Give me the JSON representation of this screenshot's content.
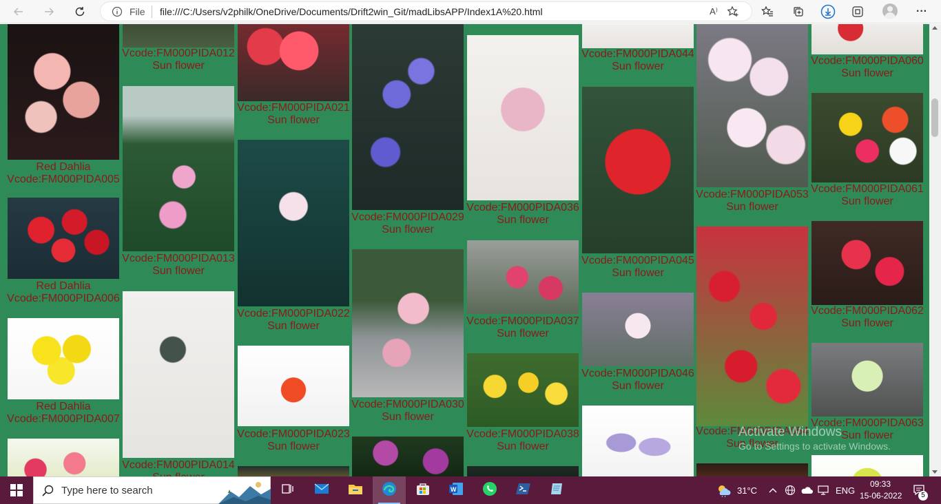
{
  "browser": {
    "back_icon": "arrow-left-icon",
    "forward_icon": "arrow-right-icon",
    "refresh_icon": "refresh-icon",
    "address_label": "File",
    "url": "file:///C:/Users/v2philk/OneDrive/Documents/Drift2win_Git/madLibsAPP/Index1A%20.html",
    "read_aloud_label": "A⁾",
    "more_label": "···"
  },
  "page": {
    "background": "#2e8b57",
    "caption_color": "#8b1a1a",
    "columns": [
      {
        "cards": [
          {
            "name": "Red Dahlia",
            "code": "Vcode:FM000PIDA005",
            "palette": "pinkrose"
          },
          {
            "name": "Red Dahlia",
            "code": "Vcode:FM000PIDA006",
            "palette": "redgerbera"
          },
          {
            "name": "Red Dahlia",
            "code": "Vcode:FM000PIDA007",
            "palette": "yellowmum"
          },
          {
            "name": "",
            "code": "",
            "palette": "tulip"
          }
        ]
      },
      {
        "cards": [
          {
            "name": "Sun flower",
            "code": "Vcode:FM000PIDA012",
            "palette": "darkgreen"
          },
          {
            "name": "Sun flower",
            "code": "Vcode:FM000PIDA013",
            "palette": "lotus"
          },
          {
            "name": "Sun flower",
            "code": "Vcode:FM000PIDA014",
            "palette": "thistle"
          }
        ]
      },
      {
        "cards": [
          {
            "name": "Sun flower",
            "code": "Vcode:FM000PIDA021",
            "palette": "begonia"
          },
          {
            "name": "Sun flower",
            "code": "Vcode:FM000PIDA022",
            "palette": "lantana"
          },
          {
            "name": "Sun flower",
            "code": "Vcode:FM000PIDA023",
            "palette": "orangegerbera"
          },
          {
            "name": "",
            "code": "",
            "palette": "sunset"
          }
        ]
      },
      {
        "cards": [
          {
            "name": "Sun flower",
            "code": "Vcode:FM000PIDA029",
            "palette": "bluebell"
          },
          {
            "name": "Sun flower",
            "code": "Vcode:FM000PIDA030",
            "palette": "blossom"
          },
          {
            "name": "",
            "code": "",
            "palette": "primrose"
          }
        ]
      },
      {
        "cards": [
          {
            "name": "Sun flower",
            "code": "Vcode:FM000PIDA036",
            "palette": "gypsophila"
          },
          {
            "name": "Sun flower",
            "code": "Vcode:FM000PIDA037",
            "palette": "pinkroses"
          },
          {
            "name": "Sun flower",
            "code": "Vcode:FM000PIDA038",
            "palette": "daffodil"
          },
          {
            "name": "",
            "code": "",
            "palette": "dark"
          }
        ]
      },
      {
        "cards": [
          {
            "name": "Sun flower",
            "code": "Vcode:FM000PIDA044",
            "palette": "whitepink"
          },
          {
            "name": "Sun flower",
            "code": "Vcode:FM000PIDA045",
            "palette": "redrose"
          },
          {
            "name": "Sun flower",
            "code": "Vcode:FM000PIDA046",
            "palette": "appleblossom"
          },
          {
            "name": "",
            "code": "",
            "palette": "wisteria"
          }
        ]
      },
      {
        "cards": [
          {
            "name": "Sun flower",
            "code": "Vcode:FM000PIDA053",
            "palette": "whitedaisy"
          },
          {
            "name": "Sun flower",
            "code": "Vcode:FM000PIDA054",
            "palette": "reddaisy"
          },
          {
            "name": "",
            "code": "",
            "palette": "lily"
          }
        ]
      },
      {
        "cards": [
          {
            "name": "Sun flower",
            "code": "Vcode:FM000PIDA060",
            "palette": "redstems"
          },
          {
            "name": "Sun flower",
            "code": "Vcode:FM000PIDA061",
            "palette": "gerbera"
          },
          {
            "name": "Sun flower",
            "code": "Vcode:FM000PIDA062",
            "palette": "reddahlia"
          },
          {
            "name": "Sun flower",
            "code": "Vcode:FM000PIDA063",
            "palette": "greenmum"
          },
          {
            "name": "",
            "code": "",
            "palette": "lime"
          }
        ]
      }
    ]
  },
  "watermark": {
    "title": "Activate Windows",
    "subtitle": "Go to Settings to activate Windows."
  },
  "taskbar": {
    "search_placeholder": "Type here to search",
    "apps": [
      "task-view-icon",
      "mail-icon",
      "file-explorer-icon",
      "edge-icon",
      "store-icon",
      "word-icon",
      "whatsapp-icon",
      "powershell-icon",
      "notepad-icon"
    ],
    "temperature": "31°C",
    "language": "ENG",
    "time": "09:33",
    "date": "15-06-2022",
    "notification_count": "5"
  }
}
